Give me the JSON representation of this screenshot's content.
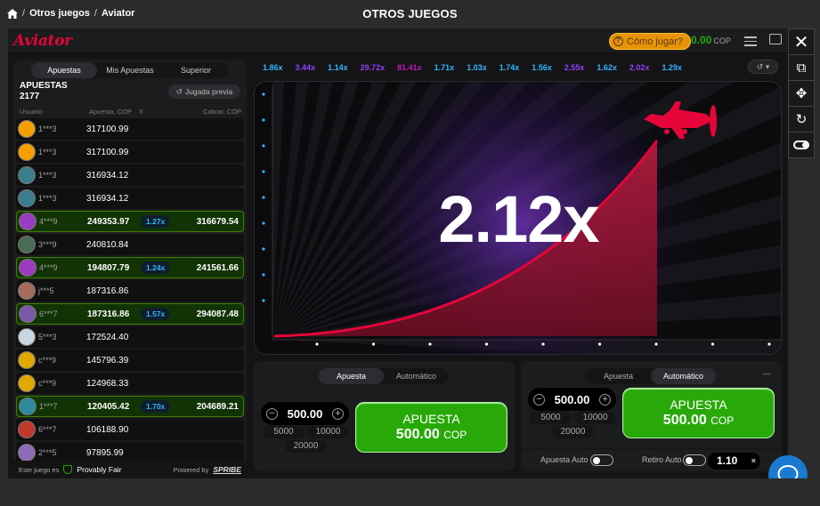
{
  "breadcrumb": {
    "home_icon": "home-icon",
    "item1": "Otros juegos",
    "item2": "Aviator",
    "sep": "/"
  },
  "page_title": "OTROS JUEGOS",
  "game": {
    "logo": "Aviator",
    "howto": "Cómo jugar?",
    "balance": "0.00",
    "currency": "COP"
  },
  "side_tools": [
    "close-icon",
    "popout-icon",
    "move-icon",
    "refresh-icon",
    "toggle-icon"
  ],
  "left": {
    "tabs": [
      "Apuestas",
      "Mis Apuestas",
      "Superior"
    ],
    "title": "APUESTAS",
    "count": "2177",
    "prev": "Jugada previa",
    "cols": {
      "user": "Usuario",
      "bet": "Apuesta, COP",
      "x": "X",
      "cash": "Cobrar, COP"
    },
    "rows": [
      {
        "user": "1***3",
        "bet": "317100.99",
        "mult": "",
        "cash": "",
        "color": "#f5a000"
      },
      {
        "user": "1***3",
        "bet": "317100.99",
        "mult": "",
        "cash": "",
        "color": "#f5a000"
      },
      {
        "user": "1***3",
        "bet": "316934.12",
        "mult": "",
        "cash": "",
        "color": "#3a7d8c"
      },
      {
        "user": "1***3",
        "bet": "316934.12",
        "mult": "",
        "cash": "",
        "color": "#3a7d8c"
      },
      {
        "user": "4***9",
        "bet": "249353.97",
        "mult": "1.27x",
        "cash": "316679.54",
        "color": "#9b3bc2"
      },
      {
        "user": "3***9",
        "bet": "240810.84",
        "mult": "",
        "cash": "",
        "color": "#4a6b55"
      },
      {
        "user": "4***9",
        "bet": "194807.79",
        "mult": "1.24x",
        "cash": "241561.66",
        "color": "#9b3bc2"
      },
      {
        "user": "j***5",
        "bet": "187316.86",
        "mult": "",
        "cash": "",
        "color": "#a66a5a"
      },
      {
        "user": "6***7",
        "bet": "187316.86",
        "mult": "1.57x",
        "cash": "294087.48",
        "color": "#7a5aa8"
      },
      {
        "user": "5***3",
        "bet": "172524.40",
        "mult": "",
        "cash": "",
        "color": "#c9d6e0"
      },
      {
        "user": "c***9",
        "bet": "145796.39",
        "mult": "",
        "cash": "",
        "color": "#e0a800"
      },
      {
        "user": "c***9",
        "bet": "124968.33",
        "mult": "",
        "cash": "",
        "color": "#e0a800"
      },
      {
        "user": "1***7",
        "bet": "120405.42",
        "mult": "1.70x",
        "cash": "204689.21",
        "color": "#2f8a9c"
      },
      {
        "user": "6***7",
        "bet": "106188.90",
        "mult": "",
        "cash": "",
        "color": "#c0392b"
      },
      {
        "user": "2***5",
        "bet": "97895.99",
        "mult": "",
        "cash": "",
        "color": "#8e6bb8"
      }
    ],
    "footer": {
      "label": "Este juego es",
      "pf": "Provably Fair",
      "powered": "Powered by",
      "brand": "SPRIBE"
    }
  },
  "history": [
    {
      "v": "1.86x",
      "c": "#34b4ff"
    },
    {
      "v": "3.44x",
      "c": "#913ef8"
    },
    {
      "v": "1.14x",
      "c": "#34b4ff"
    },
    {
      "v": "29.72x",
      "c": "#913ef8"
    },
    {
      "v": "81.41x",
      "c": "#c017b4"
    },
    {
      "v": "1.71x",
      "c": "#34b4ff"
    },
    {
      "v": "1.03x",
      "c": "#34b4ff"
    },
    {
      "v": "1.74x",
      "c": "#34b4ff"
    },
    {
      "v": "1.56x",
      "c": "#34b4ff"
    },
    {
      "v": "2.55x",
      "c": "#913ef8"
    },
    {
      "v": "1.62x",
      "c": "#34b4ff"
    },
    {
      "v": "2.02x",
      "c": "#913ef8"
    },
    {
      "v": "1.29x",
      "c": "#34b4ff"
    }
  ],
  "multiplier": "2.12x",
  "bet1": {
    "tabs": [
      "Apuesta",
      "Automático"
    ],
    "active": 0,
    "amount": "500.00",
    "q1": "5000",
    "q2": "10000",
    "q3": "20000",
    "btn_l1": "APUESTA",
    "btn_amount": "500.00",
    "btn_cur": "COP"
  },
  "bet2": {
    "tabs": [
      "Apuesta",
      "Automático"
    ],
    "active": 1,
    "amount": "500.00",
    "q1": "5000",
    "q2": "10000",
    "q3": "20000",
    "btn_l1": "APUESTA",
    "btn_amount": "500.00",
    "btn_cur": "COP",
    "auto_bet": "Apuesta Auto",
    "auto_cash": "Retiro Auto",
    "cashout_value": "1.10",
    "clear": "×",
    "minus": "—"
  }
}
